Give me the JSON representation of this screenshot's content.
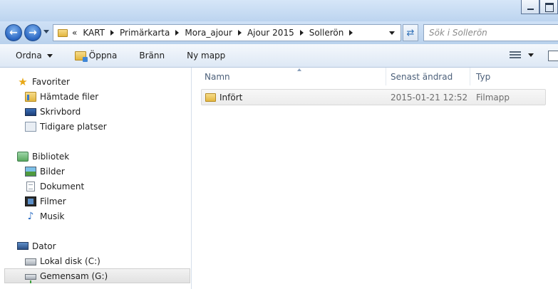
{
  "address": {
    "overflow": "«",
    "crumbs": [
      "KART",
      "Primärkarta",
      "Mora_ajour",
      "Ajour 2015",
      "Sollerön"
    ]
  },
  "search": {
    "placeholder": "Sök i Sollerön"
  },
  "toolbar": {
    "organize": "Ordna",
    "open": "Öppna",
    "burn": "Bränn",
    "new_folder": "Ny mapp"
  },
  "nav": {
    "favorites": {
      "label": "Favoriter",
      "items": [
        "Hämtade filer",
        "Skrivbord",
        "Tidigare platser"
      ]
    },
    "libraries": {
      "label": "Bibliotek",
      "items": [
        "Bilder",
        "Dokument",
        "Filmer",
        "Musik"
      ]
    },
    "computer": {
      "label": "Dator",
      "items": [
        "Lokal disk (C:)",
        "Gemensam (G:)"
      ]
    }
  },
  "columns": {
    "name": "Namn",
    "date": "Senast ändrad",
    "type": "Typ"
  },
  "files": [
    {
      "name": "Infört",
      "date": "2015-01-21 12:52",
      "type": "Filmapp"
    }
  ]
}
